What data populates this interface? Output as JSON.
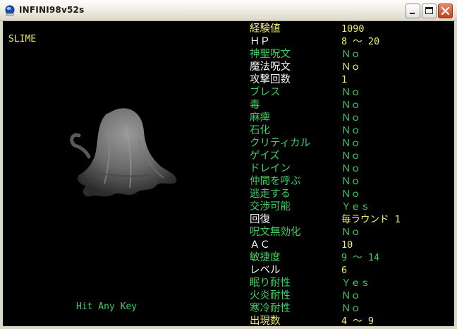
{
  "window": {
    "title": "INFINI98v52s",
    "buttons": {
      "minimize": "minimize",
      "maximize": "maximize",
      "close": "close"
    }
  },
  "monster": {
    "name": "SLIME",
    "prompt": "Hit Any Key"
  },
  "stats": [
    {
      "label": "経験値",
      "value": "1090",
      "label_color": "yellow",
      "value_color": "yellow"
    },
    {
      "label": "ＨＰ",
      "value": "8 ～ 20",
      "label_color": "white",
      "value_color": "yellow"
    },
    {
      "label": "神聖呪文",
      "value": "Ｎｏ",
      "label_color": "green",
      "value_color": "green"
    },
    {
      "label": "魔法呪文",
      "value": "Ｎｏ",
      "label_color": "white",
      "value_color": "yellow"
    },
    {
      "label": "攻撃回数",
      "value": "1",
      "label_color": "white",
      "value_color": "yellow"
    },
    {
      "label": "ブレス",
      "value": "Ｎｏ",
      "label_color": "green",
      "value_color": "green"
    },
    {
      "label": "毒",
      "value": "Ｎｏ",
      "label_color": "green",
      "value_color": "green"
    },
    {
      "label": "麻痺",
      "value": "Ｎｏ",
      "label_color": "green",
      "value_color": "green"
    },
    {
      "label": "石化",
      "value": "Ｎｏ",
      "label_color": "green",
      "value_color": "green"
    },
    {
      "label": "クリティカル",
      "value": "Ｎｏ",
      "label_color": "green",
      "value_color": "green"
    },
    {
      "label": "ゲイズ",
      "value": "Ｎｏ",
      "label_color": "green",
      "value_color": "green"
    },
    {
      "label": "ドレイン",
      "value": "Ｎｏ",
      "label_color": "green",
      "value_color": "green"
    },
    {
      "label": "仲間を呼ぶ",
      "value": "Ｎｏ",
      "label_color": "green",
      "value_color": "green"
    },
    {
      "label": "逃走する",
      "value": "Ｎｏ",
      "label_color": "green",
      "value_color": "green"
    },
    {
      "label": "交渉可能",
      "value": "Ｙｅｓ",
      "label_color": "green",
      "value_color": "green"
    },
    {
      "label": "回復",
      "value": "毎ラウンド 1",
      "label_color": "white",
      "value_color": "yellow"
    },
    {
      "label": "呪文無効化",
      "value": "Ｎｏ",
      "label_color": "green",
      "value_color": "green"
    },
    {
      "label": "ＡＣ",
      "value": "10",
      "label_color": "white",
      "value_color": "yellow"
    },
    {
      "label": "敏捷度",
      "value": "9 ～ 14",
      "label_color": "green",
      "value_color": "green"
    },
    {
      "label": "レベル",
      "value": "6",
      "label_color": "white",
      "value_color": "yellow"
    },
    {
      "label": "眠り耐性",
      "value": "Ｙｅｓ",
      "label_color": "green",
      "value_color": "green"
    },
    {
      "label": "火炎耐性",
      "value": "Ｎｏ",
      "label_color": "green",
      "value_color": "green"
    },
    {
      "label": "寒冷耐性",
      "value": "Ｎｏ",
      "label_color": "green",
      "value_color": "green"
    },
    {
      "label": "出現数",
      "value": "4 ～ 9",
      "label_color": "yellow",
      "value_color": "yellow"
    }
  ]
}
